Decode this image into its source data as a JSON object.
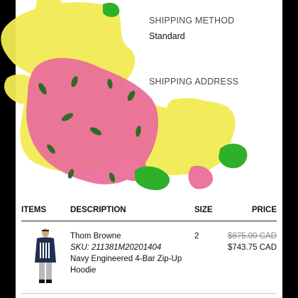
{
  "shipping_method": {
    "label": "SHIPPING METHOD",
    "value": "Standard"
  },
  "shipping_address": {
    "label": "SHIPPING ADDRESS"
  },
  "table": {
    "headers": {
      "items": "ITEMS",
      "description": "DESCRIPTION",
      "size": "SIZE",
      "price": "PRICE"
    },
    "row": {
      "brand": "Thom Browne",
      "sku": "SKU: 211381M20201404",
      "name": "Navy Engineered 4-Bar Zip-Up Hoodie",
      "size": "2",
      "original_price": "$875.00 CAD",
      "sale_price": "$743.75 CAD"
    }
  },
  "colors": {
    "scribble_yellow": "#f2ec55",
    "scribble_pink": "#ea6f9a",
    "scribble_green": "#2fb02a",
    "scribble_dark_green": "#2f6b22"
  }
}
